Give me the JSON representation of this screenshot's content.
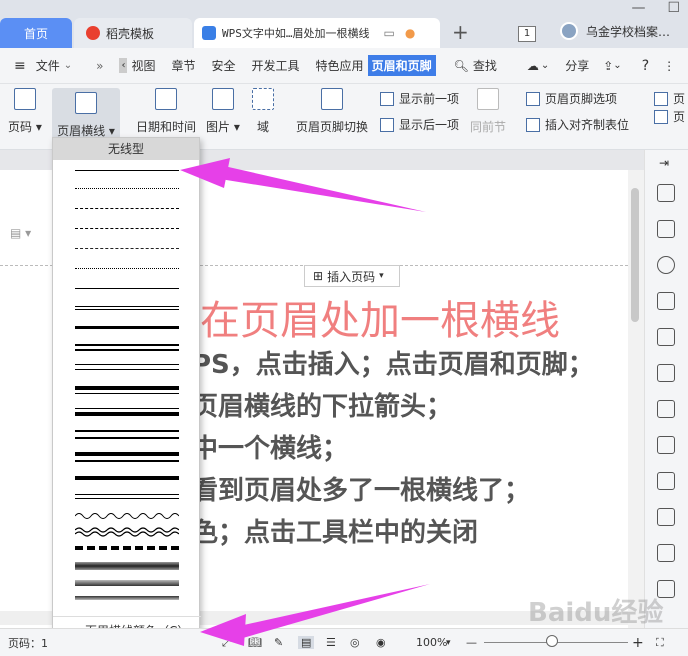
{
  "tabs": {
    "home": "首页",
    "daoke": "稻壳模板",
    "doc": "WPS文字中如…眉处加一根横线",
    "count": "1",
    "user": "乌金学校档案…"
  },
  "menu": {
    "file": "文件",
    "view": "视图",
    "chapter": "章节",
    "security": "安全",
    "dev": "开发工具",
    "features": "特色应用",
    "header_footer": "页眉和页脚",
    "find": "查找",
    "share": "分享"
  },
  "ribbon": {
    "page_num": "页码",
    "header_line": "页眉横线",
    "datetime": "日期和时间",
    "picture": "图片",
    "field": "域",
    "hf_switch": "页眉页脚切换",
    "show_prev": "显示前一项",
    "show_next": "显示后一项",
    "same_as_prev": "同前节",
    "hf_options": "页眉页脚选项",
    "insert_align_tab": "插入对齐制表位",
    "frag1": "页",
    "frag2": "页"
  },
  "dropdown": {
    "no_line": "无线型",
    "color_label": "页眉横线颜色（C）"
  },
  "document": {
    "insert_page_num": "插入页码",
    "title": "在页眉处加一根横线",
    "lines": [
      "PS，点击插入；点击页眉和页脚；",
      "页眉横线的下拉箭头；",
      "中一个横线；",
      "看到页眉处多了一根横线了；",
      "色；点击工具栏中的关闭"
    ]
  },
  "status": {
    "page": "页码：1",
    "zoom": "100%"
  },
  "watermark": "Baidu经验",
  "colors": {
    "accent": "#3e7de8",
    "home_tab": "#5b8ff4",
    "title_red": "#f07f7f",
    "arrow": "#e640e8"
  }
}
